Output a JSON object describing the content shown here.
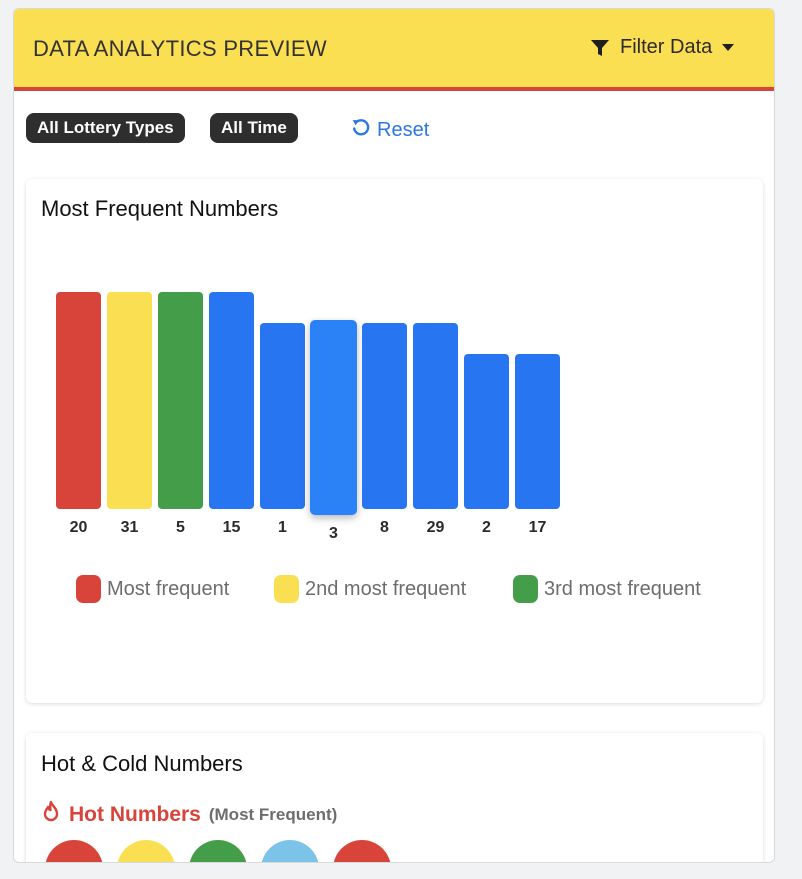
{
  "header": {
    "title": "DATA ANALYTICS PREVIEW",
    "filter_label": "Filter Data"
  },
  "chips": [
    "All Lottery Types",
    "All Time"
  ],
  "reset_label": "Reset",
  "card1": {
    "title": "Most Frequent Numbers"
  },
  "chart_data": {
    "type": "bar",
    "categories": [
      "20",
      "31",
      "5",
      "15",
      "1",
      "3",
      "8",
      "29",
      "2",
      "17"
    ],
    "values": [
      7,
      7,
      7,
      7,
      6,
      6,
      6,
      6,
      5,
      5
    ],
    "colors": [
      "#d9443a",
      "#fbdf52",
      "#449d48",
      "#2775f0",
      "#2775f0",
      "#2b82f7",
      "#2775f0",
      "#2775f0",
      "#2775f0",
      "#2775f0"
    ],
    "highlighted_index": 5,
    "legend": [
      {
        "label": "Most frequent",
        "color": "#d9443a"
      },
      {
        "label": "2nd most frequent",
        "color": "#fbdf52"
      },
      {
        "label": "3rd most frequent",
        "color": "#449d48"
      }
    ]
  },
  "card2": {
    "title": "Hot & Cold Numbers",
    "hot_label": "Hot Numbers",
    "hot_sub": "(Most Frequent)",
    "ball_colors": [
      "#d9443a",
      "#fbdf52",
      "#449d48",
      "#7cc3ea",
      "#d9443a"
    ]
  },
  "colors": {
    "header_bg": "#fbdf52",
    "accent_red": "#d9443a",
    "link_blue": "#2b78e4",
    "chip_bg": "#2e2e2e"
  }
}
